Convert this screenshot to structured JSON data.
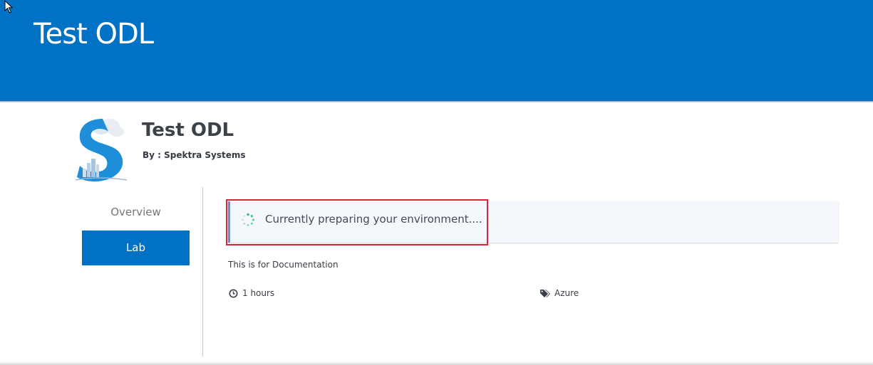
{
  "header": {
    "title": "Test ODL",
    "background_color": "#0072c6"
  },
  "course": {
    "title": "Test ODL",
    "author": "By : Spektra Systems",
    "logo_icon": "spektra-logo-icon"
  },
  "sidebar": {
    "items": [
      {
        "label": "Overview",
        "active": false
      },
      {
        "label": "Lab",
        "active": true
      }
    ]
  },
  "status": {
    "message": "Currently preparing your environment....",
    "spinner_icon": "loading-spinner-icon",
    "highlight_color": "#d72638"
  },
  "details": {
    "description": "This is for Documentation",
    "duration": "1 hours",
    "duration_icon": "clock-icon",
    "tag": "Azure",
    "tag_icon": "tags-icon"
  }
}
